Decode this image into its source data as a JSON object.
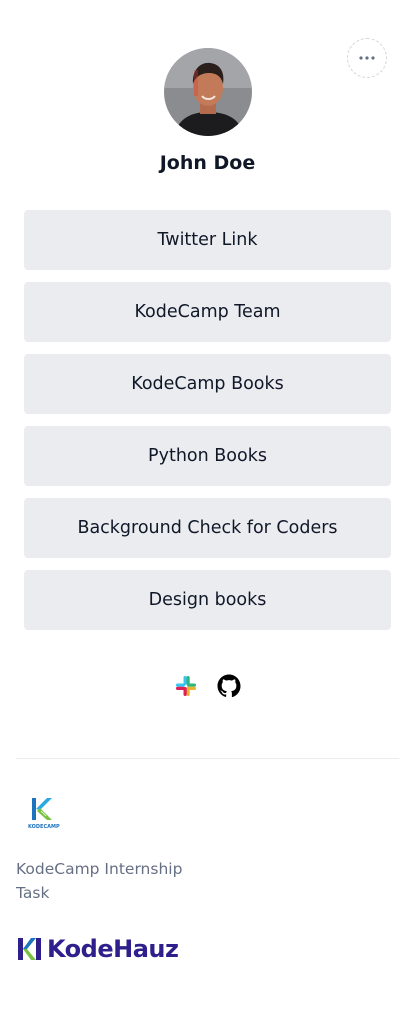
{
  "profile": {
    "name": "John Doe",
    "avatar_icon": "profile-photo"
  },
  "header": {
    "more_icon": "more-horizontal-icon"
  },
  "links": [
    {
      "label": "Twitter Link"
    },
    {
      "label": "KodeCamp Team"
    },
    {
      "label": "KodeCamp Books"
    },
    {
      "label": "Python Books"
    },
    {
      "label": "Background Check for Coders"
    },
    {
      "label": "Design books"
    }
  ],
  "social": [
    {
      "icon": "slack-icon"
    },
    {
      "icon": "github-icon"
    }
  ],
  "footer": {
    "kodecamp_logo_text": "KODECAMP",
    "text": "KodeCamp Internship Task",
    "kodehauz_brand": "KodeHauz",
    "colors": {
      "kodehauz_purple": "#2e1f8c",
      "kodehauz_green": "#7ac043",
      "kodehauz_blue": "#1e73be"
    }
  }
}
